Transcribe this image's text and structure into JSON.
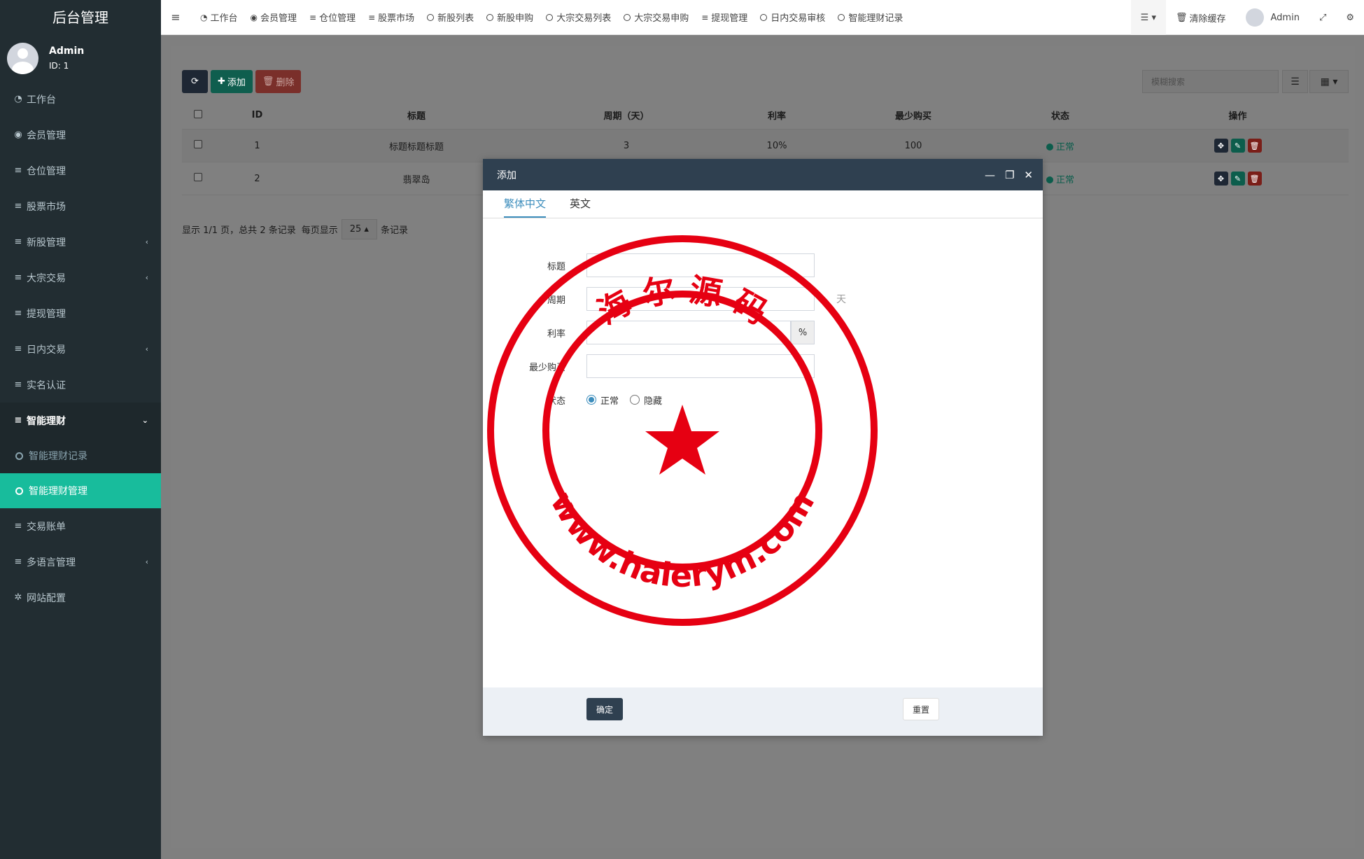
{
  "sidebar": {
    "brand": "后台管理",
    "user": {
      "name": "Admin",
      "id": "ID: 1"
    },
    "items": [
      {
        "icon": "dashboard-icon",
        "label": "工作台"
      },
      {
        "icon": "user-circle-icon",
        "label": "会员管理"
      },
      {
        "icon": "list-icon",
        "label": "仓位管理"
      },
      {
        "icon": "list-icon",
        "label": "股票市场"
      },
      {
        "icon": "list-icon",
        "label": "新股管理",
        "chevron": "‹"
      },
      {
        "icon": "list-icon",
        "label": "大宗交易",
        "chevron": "‹"
      },
      {
        "icon": "list-icon",
        "label": "提现管理"
      },
      {
        "icon": "list-icon",
        "label": "日内交易",
        "chevron": "‹"
      },
      {
        "icon": "list-icon",
        "label": "实名认证"
      },
      {
        "icon": "list-icon",
        "label": "智能理财",
        "chevron": "⌄"
      }
    ],
    "subitems": [
      {
        "label": "智能理财记录"
      },
      {
        "label": "智能理财管理"
      }
    ],
    "items_after": [
      {
        "icon": "list-icon",
        "label": "交易账单"
      },
      {
        "icon": "list-icon",
        "label": "多语言管理",
        "chevron": "‹"
      },
      {
        "icon": "gear-icon",
        "label": "网站配置"
      }
    ]
  },
  "navbar": {
    "tabs": [
      "工作台",
      "会员管理",
      "仓位管理",
      "股票市场",
      "新股列表",
      "新股申购",
      "大宗交易列表",
      "大宗交易申购",
      "提现管理",
      "日内交易审核",
      "智能理财记录"
    ],
    "clear_cache": "清除缓存",
    "user": "Admin"
  },
  "toolbar": {
    "add": "添加",
    "delete": "删除",
    "search_placeholder": "模糊搜索"
  },
  "table": {
    "headers": [
      "ID",
      "标题",
      "周期（天）",
      "利率",
      "最少购买",
      "状态",
      "操作"
    ],
    "rows": [
      {
        "id": "1",
        "title": "标题标题标题",
        "period": "3",
        "rate": "10%",
        "min": "100",
        "status": "正常"
      },
      {
        "id": "2",
        "title": "翡翠岛",
        "period": "",
        "rate": "",
        "min": "",
        "status": "正常"
      }
    ]
  },
  "pager": {
    "text_before": "显示 1/1 页，总共 2 条记录",
    "per_page_label": "每页显示",
    "per_page": "25",
    "text_after": "条记录"
  },
  "modal": {
    "title": "添加",
    "tabs": [
      "繁体中文",
      "英文"
    ],
    "fields": {
      "title": "标题",
      "period": "周期",
      "period_suffix": "天",
      "rate": "利率",
      "rate_addon": "%",
      "min": "最少购买",
      "status": "状态"
    },
    "status_options": [
      "正常",
      "隐藏"
    ],
    "ok": "确定",
    "reset": "重置"
  },
  "watermark": {
    "top_text": "海 尔 源 码",
    "bottom_text": "www.haierym.com"
  },
  "colors": {
    "sidebar": "#222d32",
    "accent": "#18bc9c",
    "primary": "#3c8dbc",
    "modal_head": "#2f4050",
    "seal": "#e60012"
  }
}
